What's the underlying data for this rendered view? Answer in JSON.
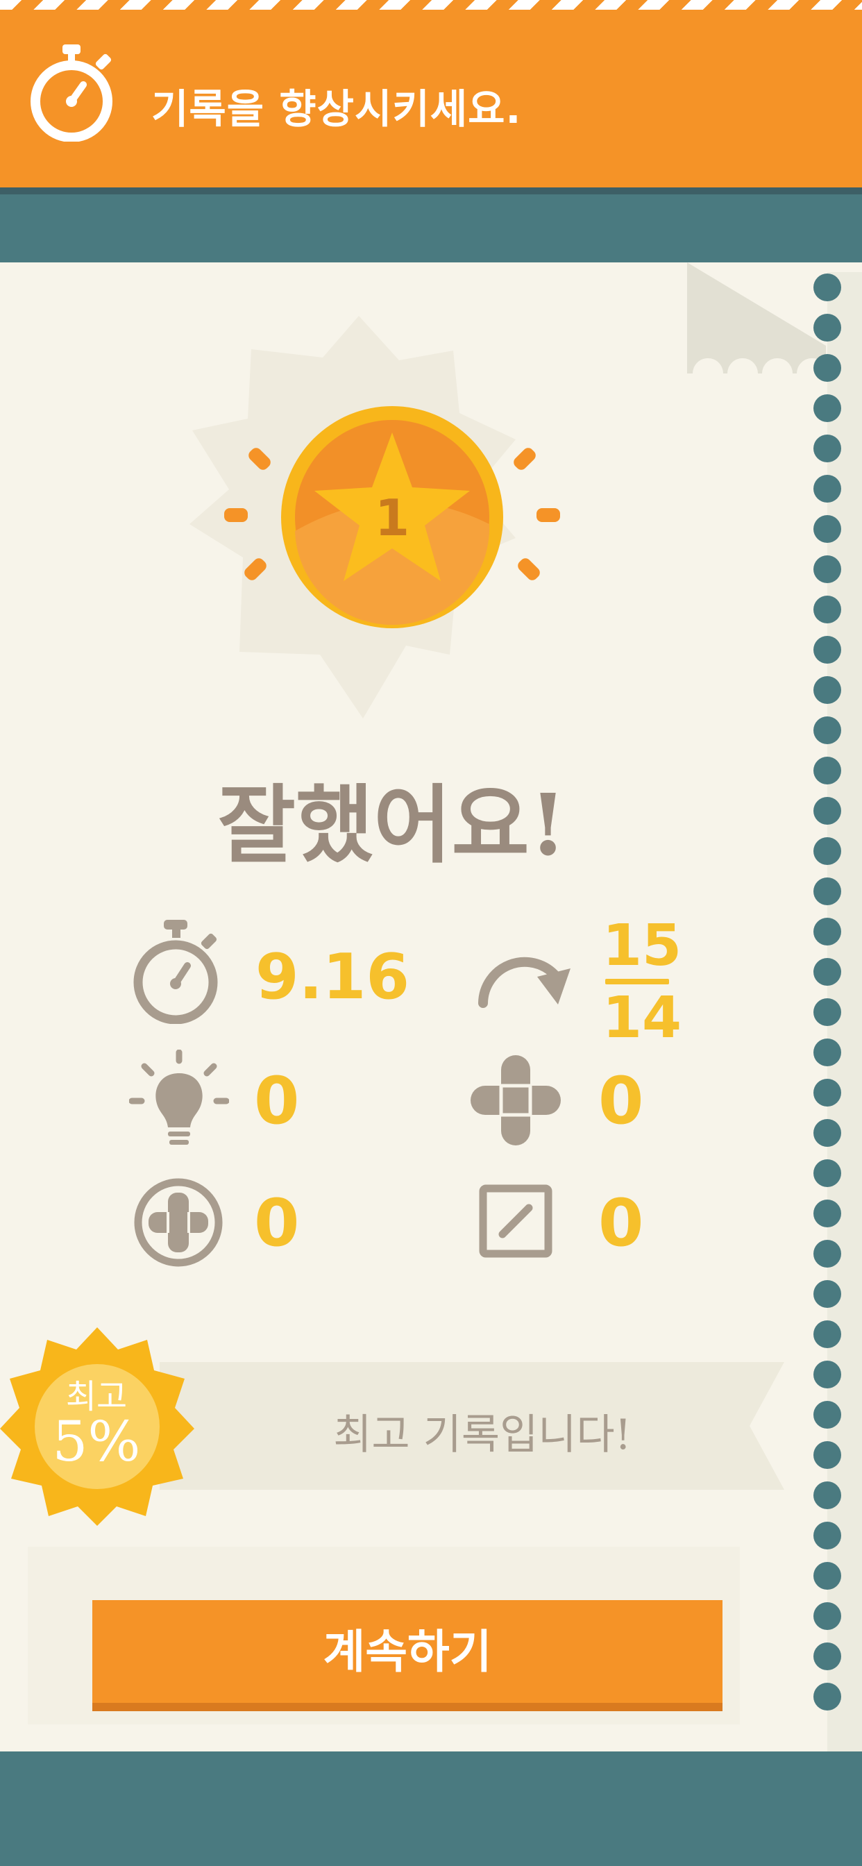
{
  "banner": {
    "title": "기록을 향상시키세요.",
    "icon": "stopwatch-icon",
    "color": "#f59327"
  },
  "medal": {
    "rank": "1"
  },
  "headline": "잘했어요!",
  "stats": {
    "time": "9.16",
    "moves_top": "15",
    "moves_bottom": "14",
    "hints": "0",
    "crossed": "0",
    "added": "0",
    "edited": "0"
  },
  "record": {
    "seal_top": "최고",
    "seal_bottom": "5%",
    "message": "최고 기록입니다!"
  },
  "continue_button": "계속하기",
  "colors": {
    "accent": "#f59327",
    "gold": "#f6c02c",
    "teal": "#4a7a80",
    "paper": "#f7f4ea",
    "text": "#9a8b7e"
  }
}
